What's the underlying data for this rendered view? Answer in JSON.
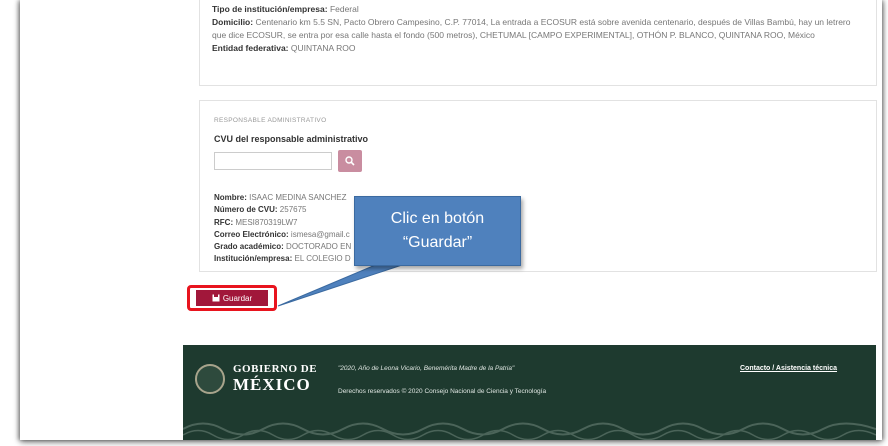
{
  "institution": {
    "tipo_label": "Tipo de institución/empresa:",
    "tipo_value": "Federal",
    "domicilio_label": "Domicilio:",
    "domicilio_value": "Centenario km 5.5 SN, Pacto Obrero Campesino, C.P. 77014, La entrada a ECOSUR está sobre avenida centenario, después de Villas Bambú, hay un letrero que dice ECOSUR, se entra por esa calle hasta el fondo (500 metros), CHETUMAL [CAMPO EXPERIMENTAL], OTHÓN P. BLANCO, QUINTANA ROO, México",
    "entidad_label": "Entidad federativa:",
    "entidad_value": "QUINTANA ROO"
  },
  "responsable": {
    "section_title": "RESPONSABLE ADMINISTRATIVO",
    "cvu_field_label": "CVU del responsable administrativo",
    "cvu_input_value": "",
    "search_icon": "search-icon",
    "nombre_label": "Nombre:",
    "nombre_value": "ISAAC MEDINA SANCHEZ",
    "cvu_label": "Número de CVU:",
    "cvu_value": "257675",
    "rfc_label": "RFC:",
    "rfc_value": "MESI870319LW7",
    "correo_label": "Correo Electrónico:",
    "correo_value": "ismesa@gmail.c",
    "grado_label": "Grado académico:",
    "grado_value": "DOCTORADO EN",
    "institucion_label": "Institución/empresa:",
    "institucion_value": "EL COLEGIO D"
  },
  "actions": {
    "save_label": "Guardar",
    "save_icon": "floppy-disk-icon"
  },
  "callout": {
    "line1": "Clic en botón",
    "line2": "“Guardar”"
  },
  "footer": {
    "gob_line1": "GOBIERNO DE",
    "gob_line2": "MÉXICO",
    "quote": "\"2020, Año de Leona Vicario, Benemérita Madre de la Patria\"",
    "rights": "Derechos reservados © 2020 Consejo Nacional de Ciencia y Tecnología",
    "contact": "Contacto / Asistencia técnica"
  },
  "colors": {
    "save_button": "#a1173a",
    "highlight": "#e8141e",
    "callout": "#4f81bd",
    "footer": "#1e3a2f",
    "search_button": "#c98da0"
  }
}
